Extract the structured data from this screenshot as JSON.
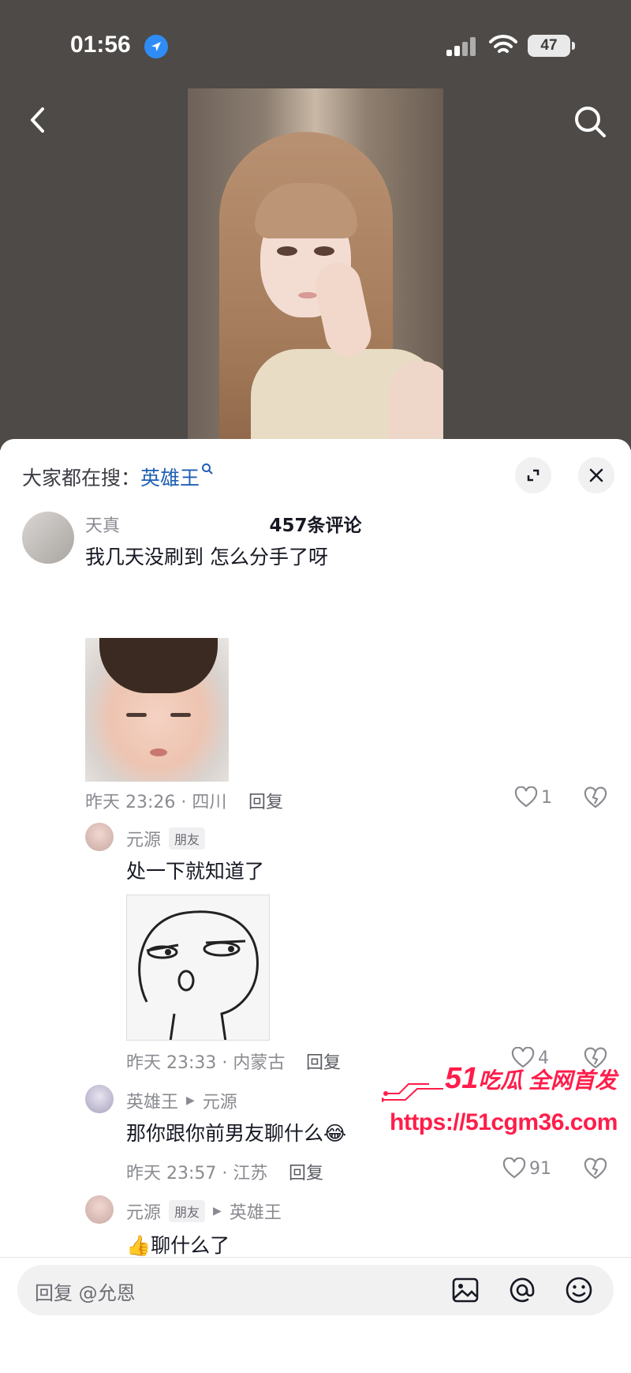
{
  "status_bar": {
    "time": "01:56",
    "battery": "47"
  },
  "panel": {
    "search_hint_prefix": "大家都在搜：",
    "search_hint_keyword": "英雄王",
    "comment_count": "457条评论"
  },
  "comments": [
    {
      "author": "天真",
      "text": "我几天没刷到 怎么分手了呀",
      "meta": "昨天 23:26 · 四川",
      "reply_label": "回复",
      "likes": "1"
    },
    {
      "author": "元源",
      "tag": "朋友",
      "text": "处一下就知道了",
      "meta": "昨天 23:33 · 内蒙古",
      "reply_label": "回复",
      "likes": "4"
    },
    {
      "author": "英雄王",
      "reply_to": "元源",
      "text": "那你跟你前男友聊什么",
      "emoji": "😂",
      "meta": "昨天 23:57 · 江苏",
      "reply_label": "回复",
      "likes": "91"
    },
    {
      "author": "元源",
      "tag": "朋友",
      "reply_to": "英雄王",
      "emoji": "👍",
      "text": "聊什么了"
    }
  ],
  "watermark": {
    "title_number": "51",
    "title_text": "吃瓜 全网首发",
    "url": "https://51cgm36.com"
  },
  "input": {
    "placeholder": "回复 @允恩"
  },
  "colors": {
    "accent_link": "#1f5fb4",
    "watermark": "#ff1d4a",
    "panel_bg": "#ffffff",
    "video_bg": "#4d4a47"
  }
}
